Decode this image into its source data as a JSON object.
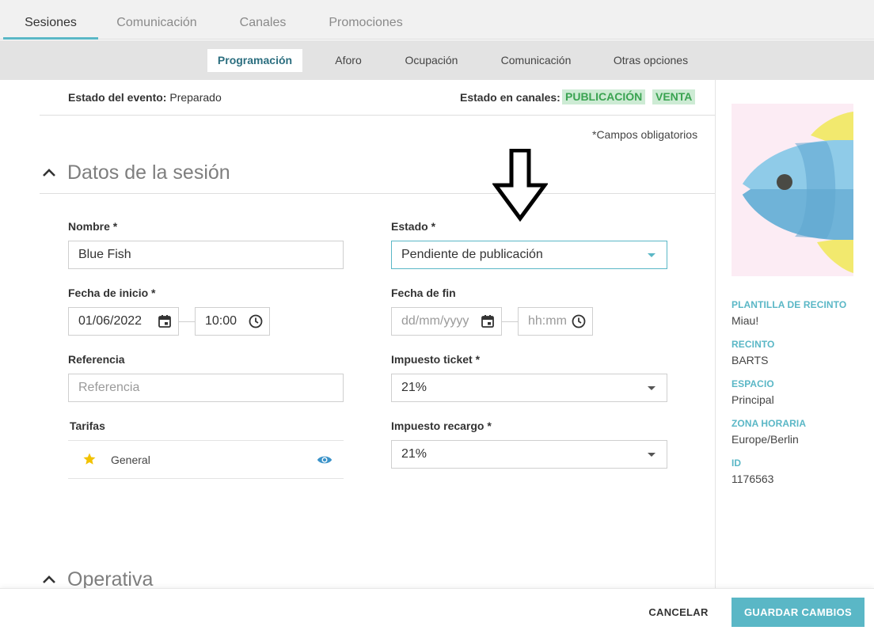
{
  "top_tabs": [
    {
      "label": "Sesiones",
      "active": true
    },
    {
      "label": "Comunicación",
      "active": false
    },
    {
      "label": "Canales",
      "active": false
    },
    {
      "label": "Promociones",
      "active": false
    }
  ],
  "sub_tabs": [
    {
      "label": "Programación",
      "active": true
    },
    {
      "label": "Aforo",
      "active": false
    },
    {
      "label": "Ocupación",
      "active": false
    },
    {
      "label": "Comunicación",
      "active": false
    },
    {
      "label": "Otras opciones",
      "active": false
    }
  ],
  "status": {
    "event_label": "Estado del evento:",
    "event_value": "Preparado",
    "channels_label": "Estado en canales:",
    "badges": [
      "PUBLICACIÓN",
      "VENTA"
    ]
  },
  "required_note": "*Campos obligatorios",
  "sections": {
    "session_title": "Datos de la sesión",
    "operativa_title": "Operativa"
  },
  "form": {
    "nombre": {
      "label": "Nombre *",
      "value": "Blue Fish"
    },
    "estado": {
      "label": "Estado *",
      "value": "Pendiente de publicación"
    },
    "fecha_inicio": {
      "label": "Fecha de inicio *",
      "date": "01/06/2022",
      "time": "10:00"
    },
    "fecha_fin": {
      "label": "Fecha de fin",
      "date_placeholder": "dd/mm/yyyy",
      "time_placeholder": "hh:mm"
    },
    "referencia": {
      "label": "Referencia",
      "placeholder": "Referencia"
    },
    "impuesto_ticket": {
      "label": "Impuesto ticket *",
      "value": "21%"
    },
    "impuesto_recargo": {
      "label": "Impuesto recargo *",
      "value": "21%"
    },
    "tarifas": {
      "label": "Tarifas",
      "items": [
        {
          "name": "General"
        }
      ]
    }
  },
  "side": {
    "items": [
      {
        "label": "PLANTILLA DE RECINTO",
        "value": "Miau!"
      },
      {
        "label": "RECINTO",
        "value": "BARTS"
      },
      {
        "label": "ESPACIO",
        "value": "Principal"
      },
      {
        "label": "ZONA HORARIA",
        "value": "Europe/Berlin"
      },
      {
        "label": "ID",
        "value": "1176563"
      }
    ]
  },
  "footer": {
    "cancel_label": "CANCELAR",
    "save_label": "GUARDAR CAMBIOS"
  },
  "colors": {
    "accent": "#5ab7c6",
    "badge_bg": "#cdebd4",
    "badge_text": "#3aa351",
    "star": "#f2c200",
    "eye": "#3b93c9"
  }
}
